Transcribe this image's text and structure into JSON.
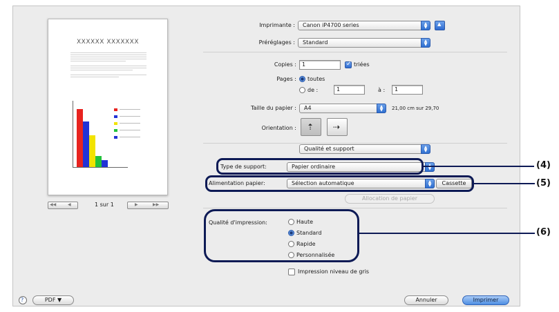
{
  "preview": {
    "doc_title": "XXXXXX XXXXXXX",
    "page_counter": "1 sur 1",
    "nav_first": "◀◀",
    "nav_prev": "◀",
    "nav_next": "▶",
    "nav_last": "▶▶"
  },
  "printer": {
    "label": "Imprimante :",
    "value": "Canon iP4700 series"
  },
  "presets": {
    "label": "Préréglages :",
    "value": "Standard"
  },
  "copies": {
    "label": "Copies :",
    "value": "1",
    "collated_label": "triées",
    "collated": true
  },
  "pages": {
    "label": "Pages :",
    "all_label": "toutes",
    "from_label": "de :",
    "from_value": "1",
    "to_label": "à :",
    "to_value": "1"
  },
  "paper_size": {
    "label": "Taille du papier :",
    "value": "A4",
    "dimensions": "21,00 cm sur 29,70"
  },
  "orientation": {
    "label": "Orientation :"
  },
  "panel_select": {
    "value": "Qualité et support"
  },
  "media_type": {
    "label": "Type de support:",
    "value": "Papier ordinaire"
  },
  "paper_source": {
    "label": "Alimentation papier:",
    "value": "Sélection automatique",
    "cassette_button": "Cassette"
  },
  "paper_allocation_button": "Allocation de papier",
  "print_quality": {
    "label": "Qualité d'impression:",
    "options": [
      "Haute",
      "Standard",
      "Rapide",
      "Personnalisée"
    ],
    "selected_index": 1
  },
  "grayscale": {
    "label": "Impression niveau de gris",
    "checked": false
  },
  "footer": {
    "help": "?",
    "pdf_button": "PDF ▼",
    "cancel_button": "Annuler",
    "print_button": "Imprimer"
  },
  "callouts": [
    "(4)",
    "(5)",
    "(6)"
  ],
  "chart_colors": [
    "#e8231f",
    "#2233d6",
    "#f2e300",
    "#22c23c",
    "#2233d6"
  ]
}
